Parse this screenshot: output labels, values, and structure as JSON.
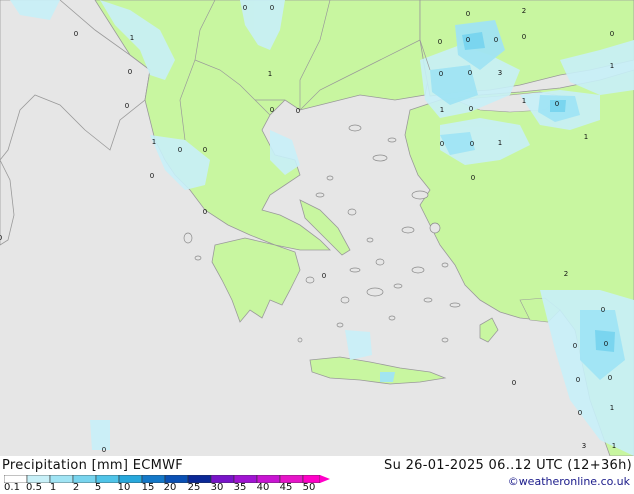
{
  "header": {
    "title_left": "Precipitation [mm]  ECMWF",
    "title_right": "Su 26-01-2025 06..12 UTC (12+36h)",
    "credit": "©weatheronline.co.uk"
  },
  "legend": {
    "tick_labels": [
      "0.1",
      "0.5",
      "1",
      "2",
      "5",
      "10",
      "15",
      "20",
      "25",
      "30",
      "35",
      "40",
      "45",
      "50"
    ],
    "colors": [
      "#ffffff",
      "#c8f0f8",
      "#a0e4f4",
      "#78d4ee",
      "#50c4e8",
      "#28a8dc",
      "#1478c8",
      "#0a50b4",
      "#0a2896",
      "#7814c8",
      "#a014d2",
      "#c814d2",
      "#e614c8",
      "#ff00c8"
    ]
  },
  "colors": {
    "sea": "#e6e6e6",
    "land_dry": "#c8f6a0",
    "precip_light": "#c8f0f8",
    "precip_medium": "#a0e4f4",
    "precip_heavy": "#78d4ee",
    "border": "#9a9a9a"
  },
  "map": {
    "cell_values": [
      "0",
      "0",
      "1",
      "0",
      "0",
      "0",
      "0",
      "0",
      "0",
      "0",
      "0",
      "1",
      "0",
      "0",
      "0",
      "0",
      "0",
      "0",
      "3",
      "1",
      "0",
      "1",
      "0",
      "1",
      "1",
      "0",
      "0",
      "1",
      "0",
      "0",
      "2",
      "2",
      "0",
      "0",
      "0",
      "0",
      "0",
      "0",
      "0",
      "1",
      "3",
      "1",
      "0",
      "0",
      "0",
      "0",
      "1",
      "0"
    ]
  }
}
